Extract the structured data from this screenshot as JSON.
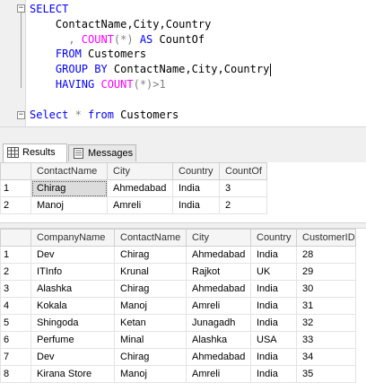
{
  "editor": {
    "lines": [
      {
        "tokens": [
          {
            "t": "SELECT",
            "c": "kw"
          }
        ]
      },
      {
        "tokens": [
          {
            "t": "    ContactName,City,Country",
            "c": "id"
          }
        ]
      },
      {
        "tokens": [
          {
            "t": "      , ",
            "c": "op"
          },
          {
            "t": "COUNT",
            "c": "fn"
          },
          {
            "t": "(*)",
            "c": "op"
          },
          {
            "t": " AS ",
            "c": "kw"
          },
          {
            "t": "CountOf",
            "c": "id"
          }
        ]
      },
      {
        "tokens": [
          {
            "t": "    FROM ",
            "c": "kw"
          },
          {
            "t": "Customers",
            "c": "id"
          }
        ]
      },
      {
        "tokens": [
          {
            "t": "    GROUP BY ",
            "c": "kw"
          },
          {
            "t": "ContactName,City,Country",
            "c": "id"
          }
        ]
      },
      {
        "tokens": [
          {
            "t": "    HAVING ",
            "c": "kw"
          },
          {
            "t": "COUNT",
            "c": "fn"
          },
          {
            "t": "(*)>1",
            "c": "op"
          }
        ]
      },
      {
        "tokens": [
          {
            "t": "",
            "c": "id"
          }
        ]
      },
      {
        "tokens": [
          {
            "t": "Select ",
            "c": "kw"
          },
          {
            "t": "* ",
            "c": "op"
          },
          {
            "t": "from ",
            "c": "kw"
          },
          {
            "t": "Customers",
            "c": "id"
          }
        ]
      }
    ],
    "colors": {
      "keyword": "#0000ff",
      "function": "#ff00ff",
      "operator": "#808080",
      "identifier": "#000000"
    }
  },
  "tabs": [
    {
      "label": "Results",
      "icon": "grid-icon",
      "active": true
    },
    {
      "label": "Messages",
      "icon": "messages-icon",
      "active": false
    }
  ],
  "grid1": {
    "columns": [
      "ContactName",
      "City",
      "Country",
      "CountOf"
    ],
    "rows": [
      {
        "num": "1",
        "cells": [
          "Chirag",
          "Ahmedabad",
          "India",
          "3"
        ]
      },
      {
        "num": "2",
        "cells": [
          "Manoj",
          "Amreli",
          "India",
          "2"
        ]
      }
    ]
  },
  "grid2": {
    "columns": [
      "CompanyName",
      "ContactName",
      "City",
      "Country",
      "CustomerID"
    ],
    "rows": [
      {
        "num": "1",
        "cells": [
          "Dev",
          "Chirag",
          "Ahmedabad",
          "India",
          "28"
        ]
      },
      {
        "num": "2",
        "cells": [
          "ITInfo",
          "Krunal",
          "Rajkot",
          "UK",
          "29"
        ]
      },
      {
        "num": "3",
        "cells": [
          "Alashka",
          "Chirag",
          "Ahmedabad",
          "India",
          "30"
        ]
      },
      {
        "num": "4",
        "cells": [
          "Kokala",
          "Manoj",
          "Amreli",
          "India",
          "31"
        ]
      },
      {
        "num": "5",
        "cells": [
          "Shingoda",
          "Ketan",
          "Junagadh",
          "India",
          "32"
        ]
      },
      {
        "num": "6",
        "cells": [
          "Perfume",
          "Minal",
          "Alashka",
          "USA",
          "33"
        ]
      },
      {
        "num": "7",
        "cells": [
          "Dev",
          "Chirag",
          "Ahmedabad",
          "India",
          "34"
        ]
      },
      {
        "num": "8",
        "cells": [
          "Kirana Store",
          "Manoj",
          "Amreli",
          "India",
          "35"
        ]
      }
    ]
  }
}
